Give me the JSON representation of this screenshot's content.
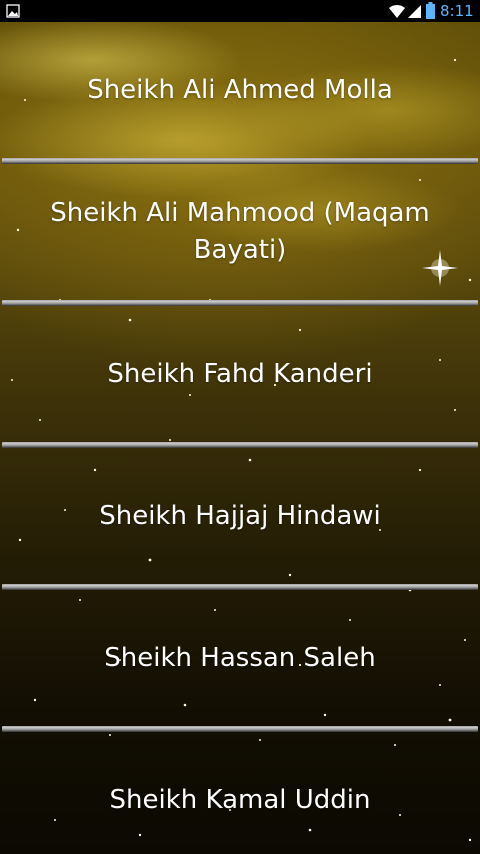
{
  "status_bar": {
    "time": "8:11",
    "icons": [
      "gallery-notification-icon",
      "wifi-icon",
      "signal-icon",
      "battery-icon"
    ],
    "clock_color": "#5ab4ff"
  },
  "reciters": [
    {
      "label": "Sheikh Ali Ahmed Molla"
    },
    {
      "label": "Sheikh Ali Mahmood (Maqam Bayati)"
    },
    {
      "label": "Sheikh Fahd Kanderi"
    },
    {
      "label": "Sheikh Hajjaj Hindawi"
    },
    {
      "label": "Sheikh Hassan Saleh"
    },
    {
      "label": "Sheikh Kamal Uddin"
    }
  ],
  "theme": {
    "text_color": "#ffffff",
    "divider_color": "#b5b5b5",
    "background_top": "#6a560c",
    "background_bottom": "#0b0902"
  }
}
